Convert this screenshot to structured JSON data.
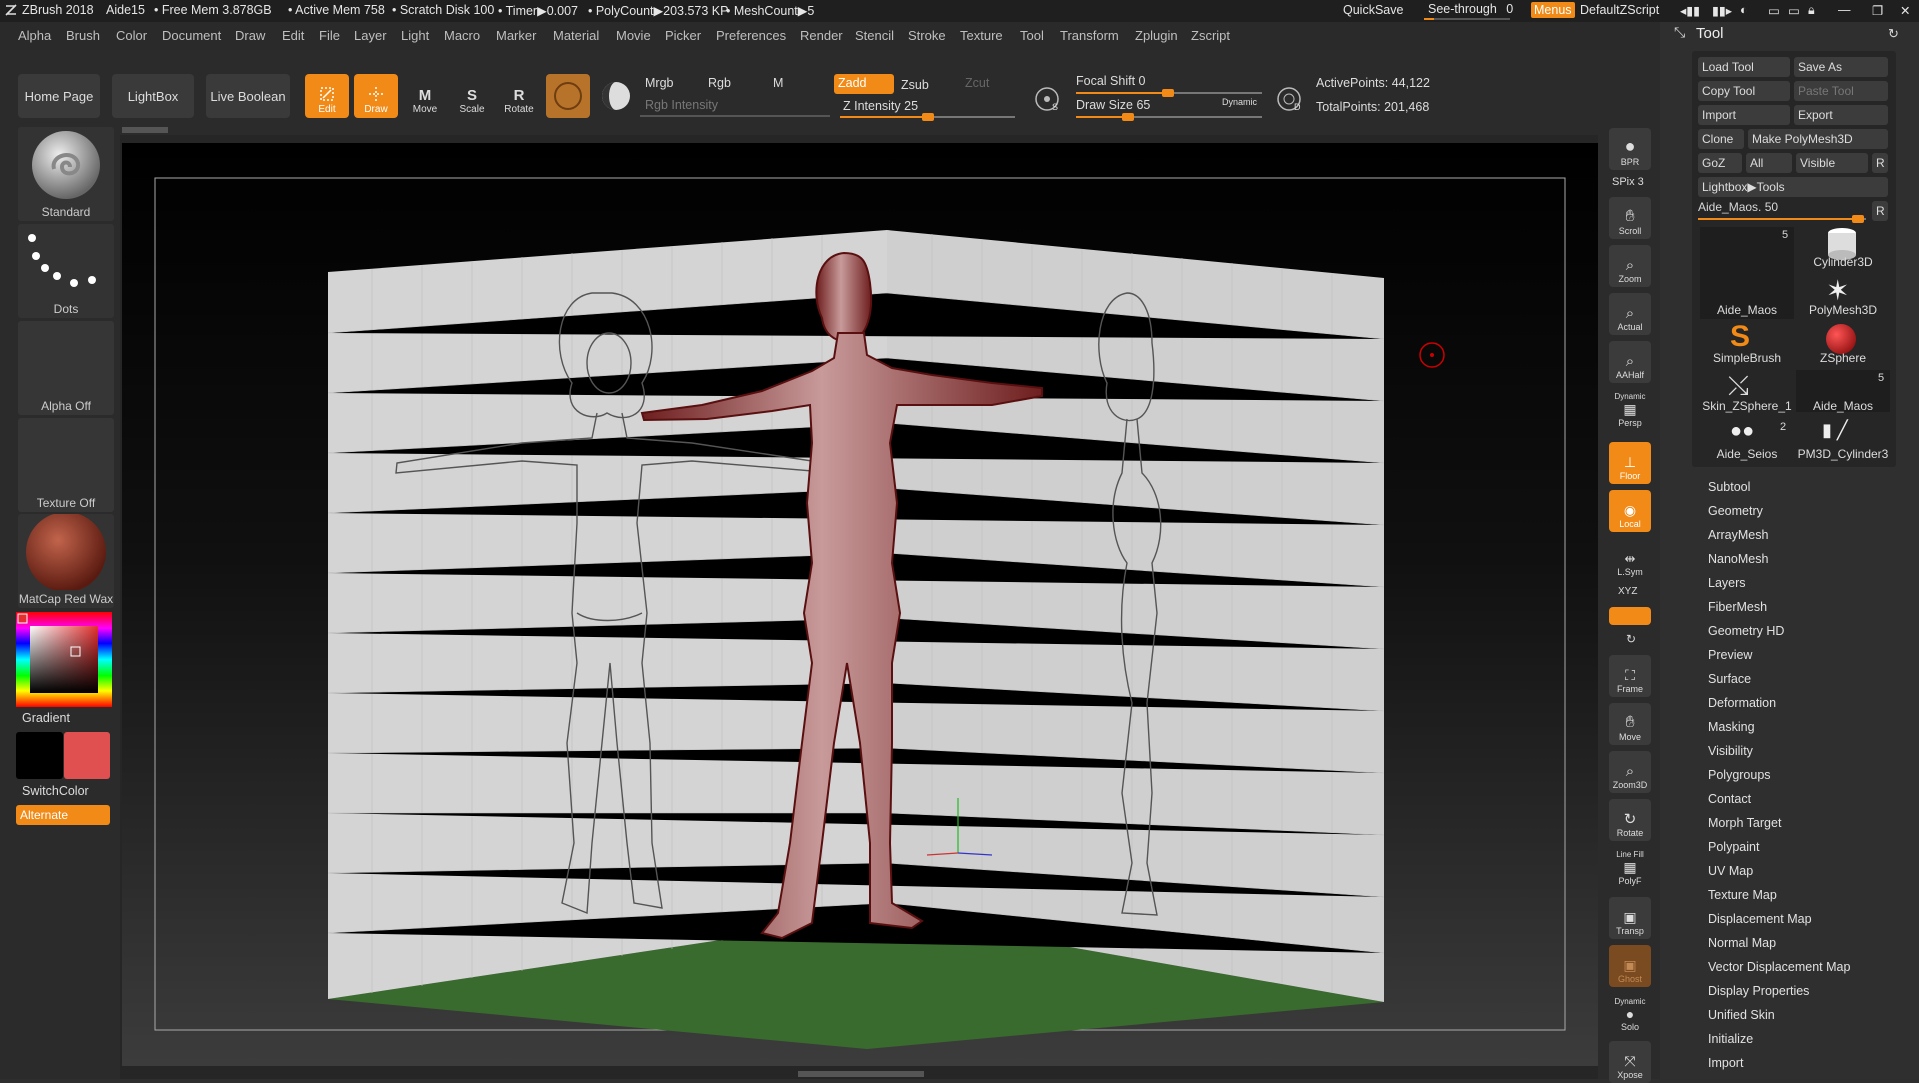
{
  "titlebar": {
    "app": "ZBrush 2018",
    "document": "Aide15",
    "free_mem": "• Free Mem 3.878GB",
    "active_mem": "• Active Mem 758",
    "scratch_disk": "• Scratch Disk 100",
    "timer": "• Timer▶0.007",
    "polycount": "• PolyCount▶203.573 KP",
    "meshcount": "• MeshCount▶5",
    "quicksave": "QuickSave",
    "see_through": "See-through",
    "see_through_value": "0",
    "menus": "Menus",
    "script": "DefaultZScript"
  },
  "menubar": [
    "Alpha",
    "Brush",
    "Color",
    "Document",
    "Draw",
    "Edit",
    "File",
    "Layer",
    "Light",
    "Macro",
    "Marker",
    "Material",
    "Movie",
    "Picker",
    "Preferences",
    "Render",
    "Stencil",
    "Stroke",
    "Texture",
    "Tool",
    "Transform",
    "Zplugin",
    "Zscript"
  ],
  "toolbar": {
    "home_page": "Home Page",
    "lightbox": "LightBox",
    "live_boolean": "Live Boolean",
    "edit": "Edit",
    "draw": "Draw",
    "move": "Move",
    "scale": "Scale",
    "rotate": "Rotate",
    "mrgb": "Mrgb",
    "rgb": "Rgb",
    "m": "M",
    "rgb_intensity": "Rgb Intensity",
    "zadd": "Zadd",
    "zsub": "Zsub",
    "zcut": "Zcut",
    "z_intensity_label": "Z Intensity",
    "z_intensity_value": "25",
    "focal_shift_label": "Focal Shift",
    "focal_shift_value": "0",
    "draw_size_label": "Draw Size",
    "draw_size_value": "65",
    "dynamic": "Dynamic",
    "active_points": "ActivePoints: 44,122",
    "total_points": "TotalPoints: 201,468"
  },
  "left_shelf": {
    "brush": "Standard",
    "stroke": "Dots",
    "alpha": "Alpha Off",
    "texture": "Texture Off",
    "material": "MatCap Red Wax",
    "gradient": "Gradient",
    "switch_color": "SwitchColor",
    "alternate": "Alternate",
    "secondary_color": "#e05050"
  },
  "right_shelf": [
    "BPR",
    "SPix 3",
    "Scroll",
    "Zoom",
    "Actual",
    "AAHalf",
    "Persp",
    "Floor",
    "Local",
    "L.Sym",
    "Frame",
    "Move",
    "Zoom3D",
    "Rotate",
    "PolyF",
    "Transp",
    "Ghost",
    "Solo",
    "Xpose"
  ],
  "right_shelf_labels": {
    "dynamic": "Dynamic",
    "line_fill": "Line Fill",
    "xyz": "XYZ"
  },
  "tool_panel": {
    "title": "Tool",
    "load_tool": "Load Tool",
    "save_as": "Save As",
    "copy_tool": "Copy Tool",
    "paste_tool": "Paste Tool",
    "import": "Import",
    "export": "Export",
    "clone": "Clone",
    "make_polymesh": "Make PolyMesh3D",
    "goz": "GoZ",
    "all": "All",
    "visible": "Visible",
    "r": "R",
    "lightbox_tools": "Lightbox▶Tools",
    "current_tool": "Aide_Maos.",
    "current_value": "50",
    "thumbs": [
      {
        "name": "Aide_Maos",
        "count": "5"
      },
      {
        "name": "Cylinder3D",
        "count": ""
      },
      {
        "name": "PolyMesh3D",
        "count": ""
      },
      {
        "name": "SimpleBrush",
        "count": ""
      },
      {
        "name": "ZSphere",
        "count": ""
      },
      {
        "name": "Skin_ZSphere_1",
        "count": ""
      },
      {
        "name": "Aide_Maos",
        "count": "5"
      },
      {
        "name": "Aide_Seios",
        "count": "2"
      },
      {
        "name": "PM3D_Cylinder3",
        "count": ""
      }
    ],
    "subpalettes": [
      "Subtool",
      "Geometry",
      "ArrayMesh",
      "NanoMesh",
      "Layers",
      "FiberMesh",
      "Geometry HD",
      "Preview",
      "Surface",
      "Deformation",
      "Masking",
      "Visibility",
      "Polygroups",
      "Contact",
      "Morph Target",
      "Polypaint",
      "UV Map",
      "Texture Map",
      "Displacement Map",
      "Normal Map",
      "Vector Displacement Map",
      "Display Properties",
      "Unified Skin",
      "Initialize",
      "Import"
    ]
  },
  "accent": "#f18a16"
}
